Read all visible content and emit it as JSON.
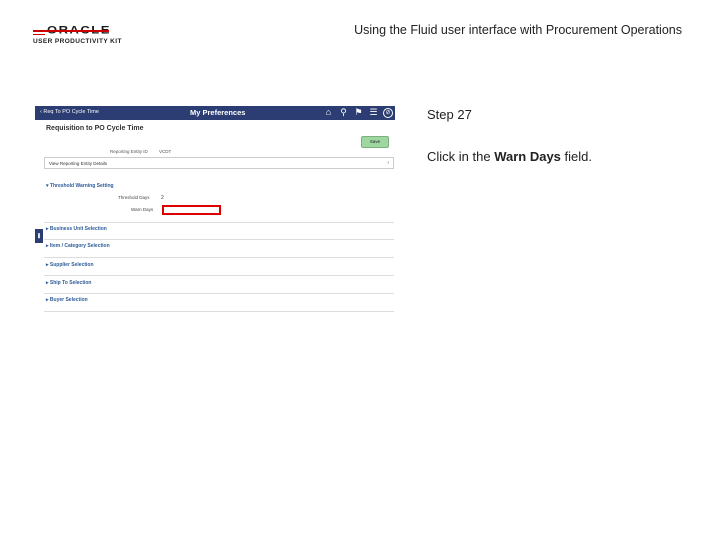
{
  "logo": {
    "oracle": "ORACLE",
    "sub": "USER PRODUCTIVITY KIT",
    "color": "#c00000"
  },
  "doc_title": "Using the Fluid user interface with Procurement Operations",
  "screenshot": {
    "back_label": "Req To PO Cycle Time",
    "bar_title": "My Preferences",
    "bar_icons": [
      "home-icon",
      "search-icon",
      "flag-icon",
      "menu-icon",
      "circle-icon"
    ],
    "page_title": "Requisition to PO Cycle Time",
    "save_label": "Save",
    "reporting_entity_label": "Reporting Entity ID",
    "reporting_entity_value": "VCDT",
    "detail_label": "View Reporting Entity Details",
    "section_threshold": "Threshold Warning Setting",
    "threshold_days_label": "Threshold Days",
    "threshold_days_value": "2",
    "warn_days_label": "Warn Days",
    "sections": [
      "Business Unit Selection",
      "Item / Category Selection",
      "Supplier Selection",
      "Ship To Selection",
      "Buyer Selection"
    ],
    "colors": {
      "bar": "#2b3d72",
      "save": "#9fd7a0",
      "highlight": "#dd0000",
      "section": "#2e5c9a"
    }
  },
  "step": "Step 27",
  "instruction": {
    "before": "Click in the ",
    "field": "Warn Days",
    "after": " field."
  }
}
